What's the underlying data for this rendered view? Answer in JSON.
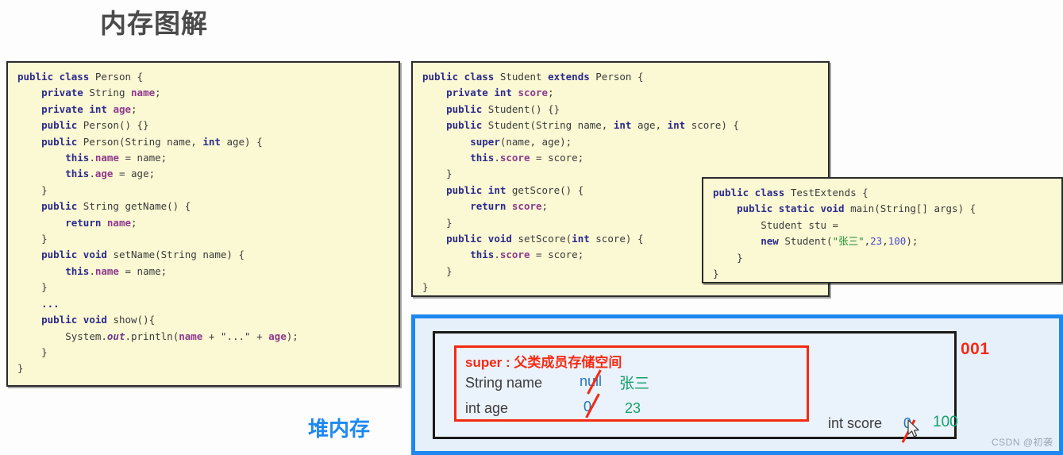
{
  "page": {
    "title": "内存图解",
    "background_color": "#fdfdfd"
  },
  "panels": [
    {
      "id": "person",
      "name": "Person class source",
      "code": "public class Person {\n    private String name;\n    private int age;\n    public Person() {}\n    public Person(String name, int age) {\n        this.name = name;\n        this.age = age;\n    }\n    public String getName() {\n        return name;\n    }\n    public void setName(String name) {\n        this.name = name;\n    }\n    ...\n    public void show(){\n        System.out.println(name + \"...\" + age);\n    }\n}"
    },
    {
      "id": "student",
      "name": "Student class source",
      "code": "public class Student extends Person {\n    private int score;\n    public Student() {}\n    public Student(String name, int age, int score) {\n        super(name, age);\n        this.score = score;\n    }\n    public int getScore() {\n        return score;\n    }\n    public void setScore(int score) {\n        this.score = score;\n    }\n}"
    },
    {
      "id": "test",
      "name": "TestExtends class source",
      "code": "public class TestExtends {\n    public static void main(String[] args) {\n        Student stu =\n        new Student(\"张三\",23,100);\n    }\n}"
    }
  ],
  "heap": {
    "label": "堆内存",
    "address": "001",
    "super_box": {
      "title": "super : 父类成员存储空间",
      "fields": [
        {
          "declaration": "String name",
          "old_value": "null",
          "new_value": "张三"
        },
        {
          "declaration": "int age",
          "old_value": "0",
          "new_value": "23"
        }
      ]
    },
    "child_field": {
      "declaration": "int score",
      "old_value": "0",
      "new_value": "100"
    }
  },
  "colors": {
    "code_background": "#fbf8d4",
    "keyword": "#2b2b8c",
    "field": "#8d3a8d",
    "string": "#1a8a2f",
    "number": "#4a4ac8",
    "heap_blue": "#1e88f0",
    "red_accent": "#f42a12",
    "old_value_blue": "#2176c7",
    "new_value_green": "#15a06b"
  },
  "watermark": "CSDN @初袭"
}
